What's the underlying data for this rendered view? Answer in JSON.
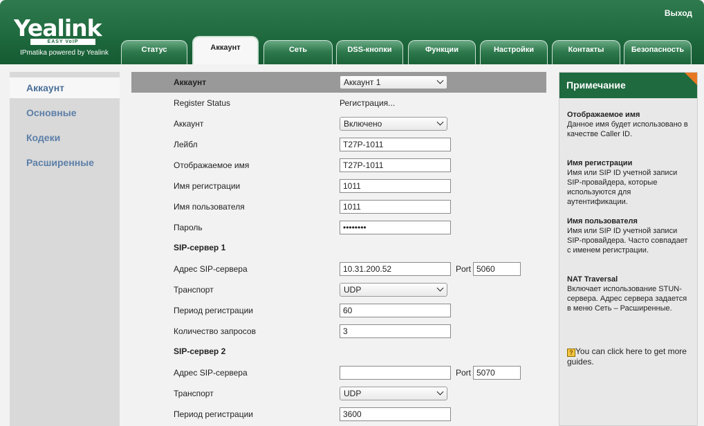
{
  "header": {
    "brand": "Yealink",
    "brand_sub": "EASY VoIP",
    "powered_by": "IPmatika powered by Yealink",
    "logout": "Выход",
    "tabs": [
      {
        "label": "Статус"
      },
      {
        "label": "Аккаунт"
      },
      {
        "label": "Сеть"
      },
      {
        "label": "DSS-кнопки"
      },
      {
        "label": "Функции"
      },
      {
        "label": "Настройки"
      },
      {
        "label": "Контакты"
      },
      {
        "label": "Безопасность"
      }
    ],
    "active_tab": "Аккаунт"
  },
  "sidebar": {
    "items": [
      {
        "label": "Аккаунт"
      },
      {
        "label": "Основные"
      },
      {
        "label": "Кодеки"
      },
      {
        "label": "Расширенные"
      }
    ],
    "active": "Аккаунт"
  },
  "form": {
    "account_select": {
      "label": "Аккаунт",
      "value": "Аккаунт 1"
    },
    "register_status": {
      "label": "Register Status",
      "value": "Регистрация..."
    },
    "account_enabled": {
      "label": "Аккаунт",
      "value": "Включено"
    },
    "label_field": {
      "label": "Лейбл",
      "value": "T27P-1011"
    },
    "display_name": {
      "label": "Отображаемое имя",
      "value": "T27P-1011"
    },
    "register_name": {
      "label": "Имя регистрации",
      "value": "1011"
    },
    "user_name": {
      "label": "Имя пользователя",
      "value": "1011"
    },
    "password": {
      "label": "Пароль",
      "value": "••••••••"
    },
    "sip1": {
      "title": "SIP-сервер 1",
      "address": {
        "label": "Адрес SIP-сервера",
        "value": "10.31.200.52"
      },
      "port": {
        "label": "Port",
        "value": "5060"
      },
      "transport": {
        "label": "Транспорт",
        "value": "UDP"
      },
      "period": {
        "label": "Период регистрации",
        "value": "60"
      },
      "retries": {
        "label": "Количество запросов",
        "value": "3"
      }
    },
    "sip2": {
      "title": "SIP-сервер 2",
      "address": {
        "label": "Адрес SIP-сервера",
        "value": ""
      },
      "port": {
        "label": "Port",
        "value": "5070"
      },
      "transport": {
        "label": "Транспорт",
        "value": "UDP"
      },
      "period": {
        "label": "Период регистрации",
        "value": "3600"
      }
    }
  },
  "note": {
    "title": "Примечание",
    "sections": [
      {
        "heading": "Отображаемое имя",
        "text": "Данное имя будет использовано в качестве Caller ID."
      },
      {
        "heading": "Имя регистрации",
        "text": "Имя или SIP ID учетной записи SIP-провайдера, которые используются для аутентификации."
      },
      {
        "heading": "Имя пользователя",
        "text": "Имя или SIP ID учетной записи SIP-провайдера. Часто совпадает с именем регистрации."
      },
      {
        "heading": "NAT Traversal",
        "text": "Включает использование STUN-сервера. Адрес сервера задается в меню Сеть – Расширенные."
      }
    ],
    "guide_icon_char": "?",
    "guide_text": "You can click here to get more guides."
  },
  "colors": {
    "header_green": "#1f6a3f",
    "nav_link": "#5c7fa8",
    "note_accent": "#e87722"
  }
}
